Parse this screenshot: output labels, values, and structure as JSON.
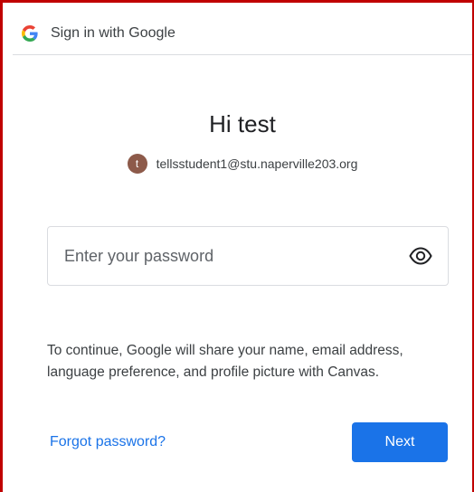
{
  "header": {
    "logo_icon": "google-g-icon",
    "title": "Sign in with Google"
  },
  "greeting": "Hi test",
  "account": {
    "avatar_initial": "t",
    "avatar_color": "#8d5a4a",
    "email": "tellsstudent1@stu.naperville203.org"
  },
  "password": {
    "placeholder": "Enter your password",
    "value": "",
    "toggle_icon": "eye-icon"
  },
  "disclosure": "To continue, Google will share your name, email address, language preference, and profile picture with Canvas.",
  "actions": {
    "forgot_label": "Forgot password?",
    "next_label": "Next"
  },
  "colors": {
    "accent": "#1a73e8",
    "frame_border": "#c00000"
  }
}
